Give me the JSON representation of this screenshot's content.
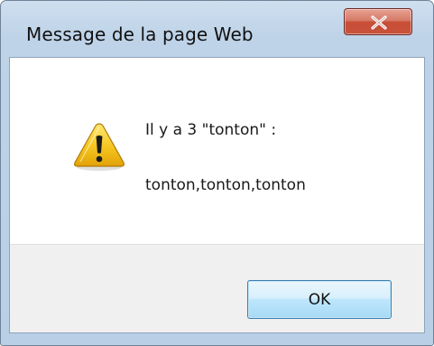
{
  "window": {
    "title": "Message de la page Web",
    "close_label": "x"
  },
  "dialog": {
    "icon": "warning-icon",
    "line1": "Il y a 3 \"tonton\" :",
    "line2": "tonton,tonton,tonton",
    "ok_label": "OK"
  },
  "colors": {
    "title_bar": "#bed3e8",
    "close_button": "#c84d36",
    "ok_button_border": "#3c7fb1",
    "footer_background": "#f0f0f0",
    "warning_icon": "#f2c21b"
  }
}
